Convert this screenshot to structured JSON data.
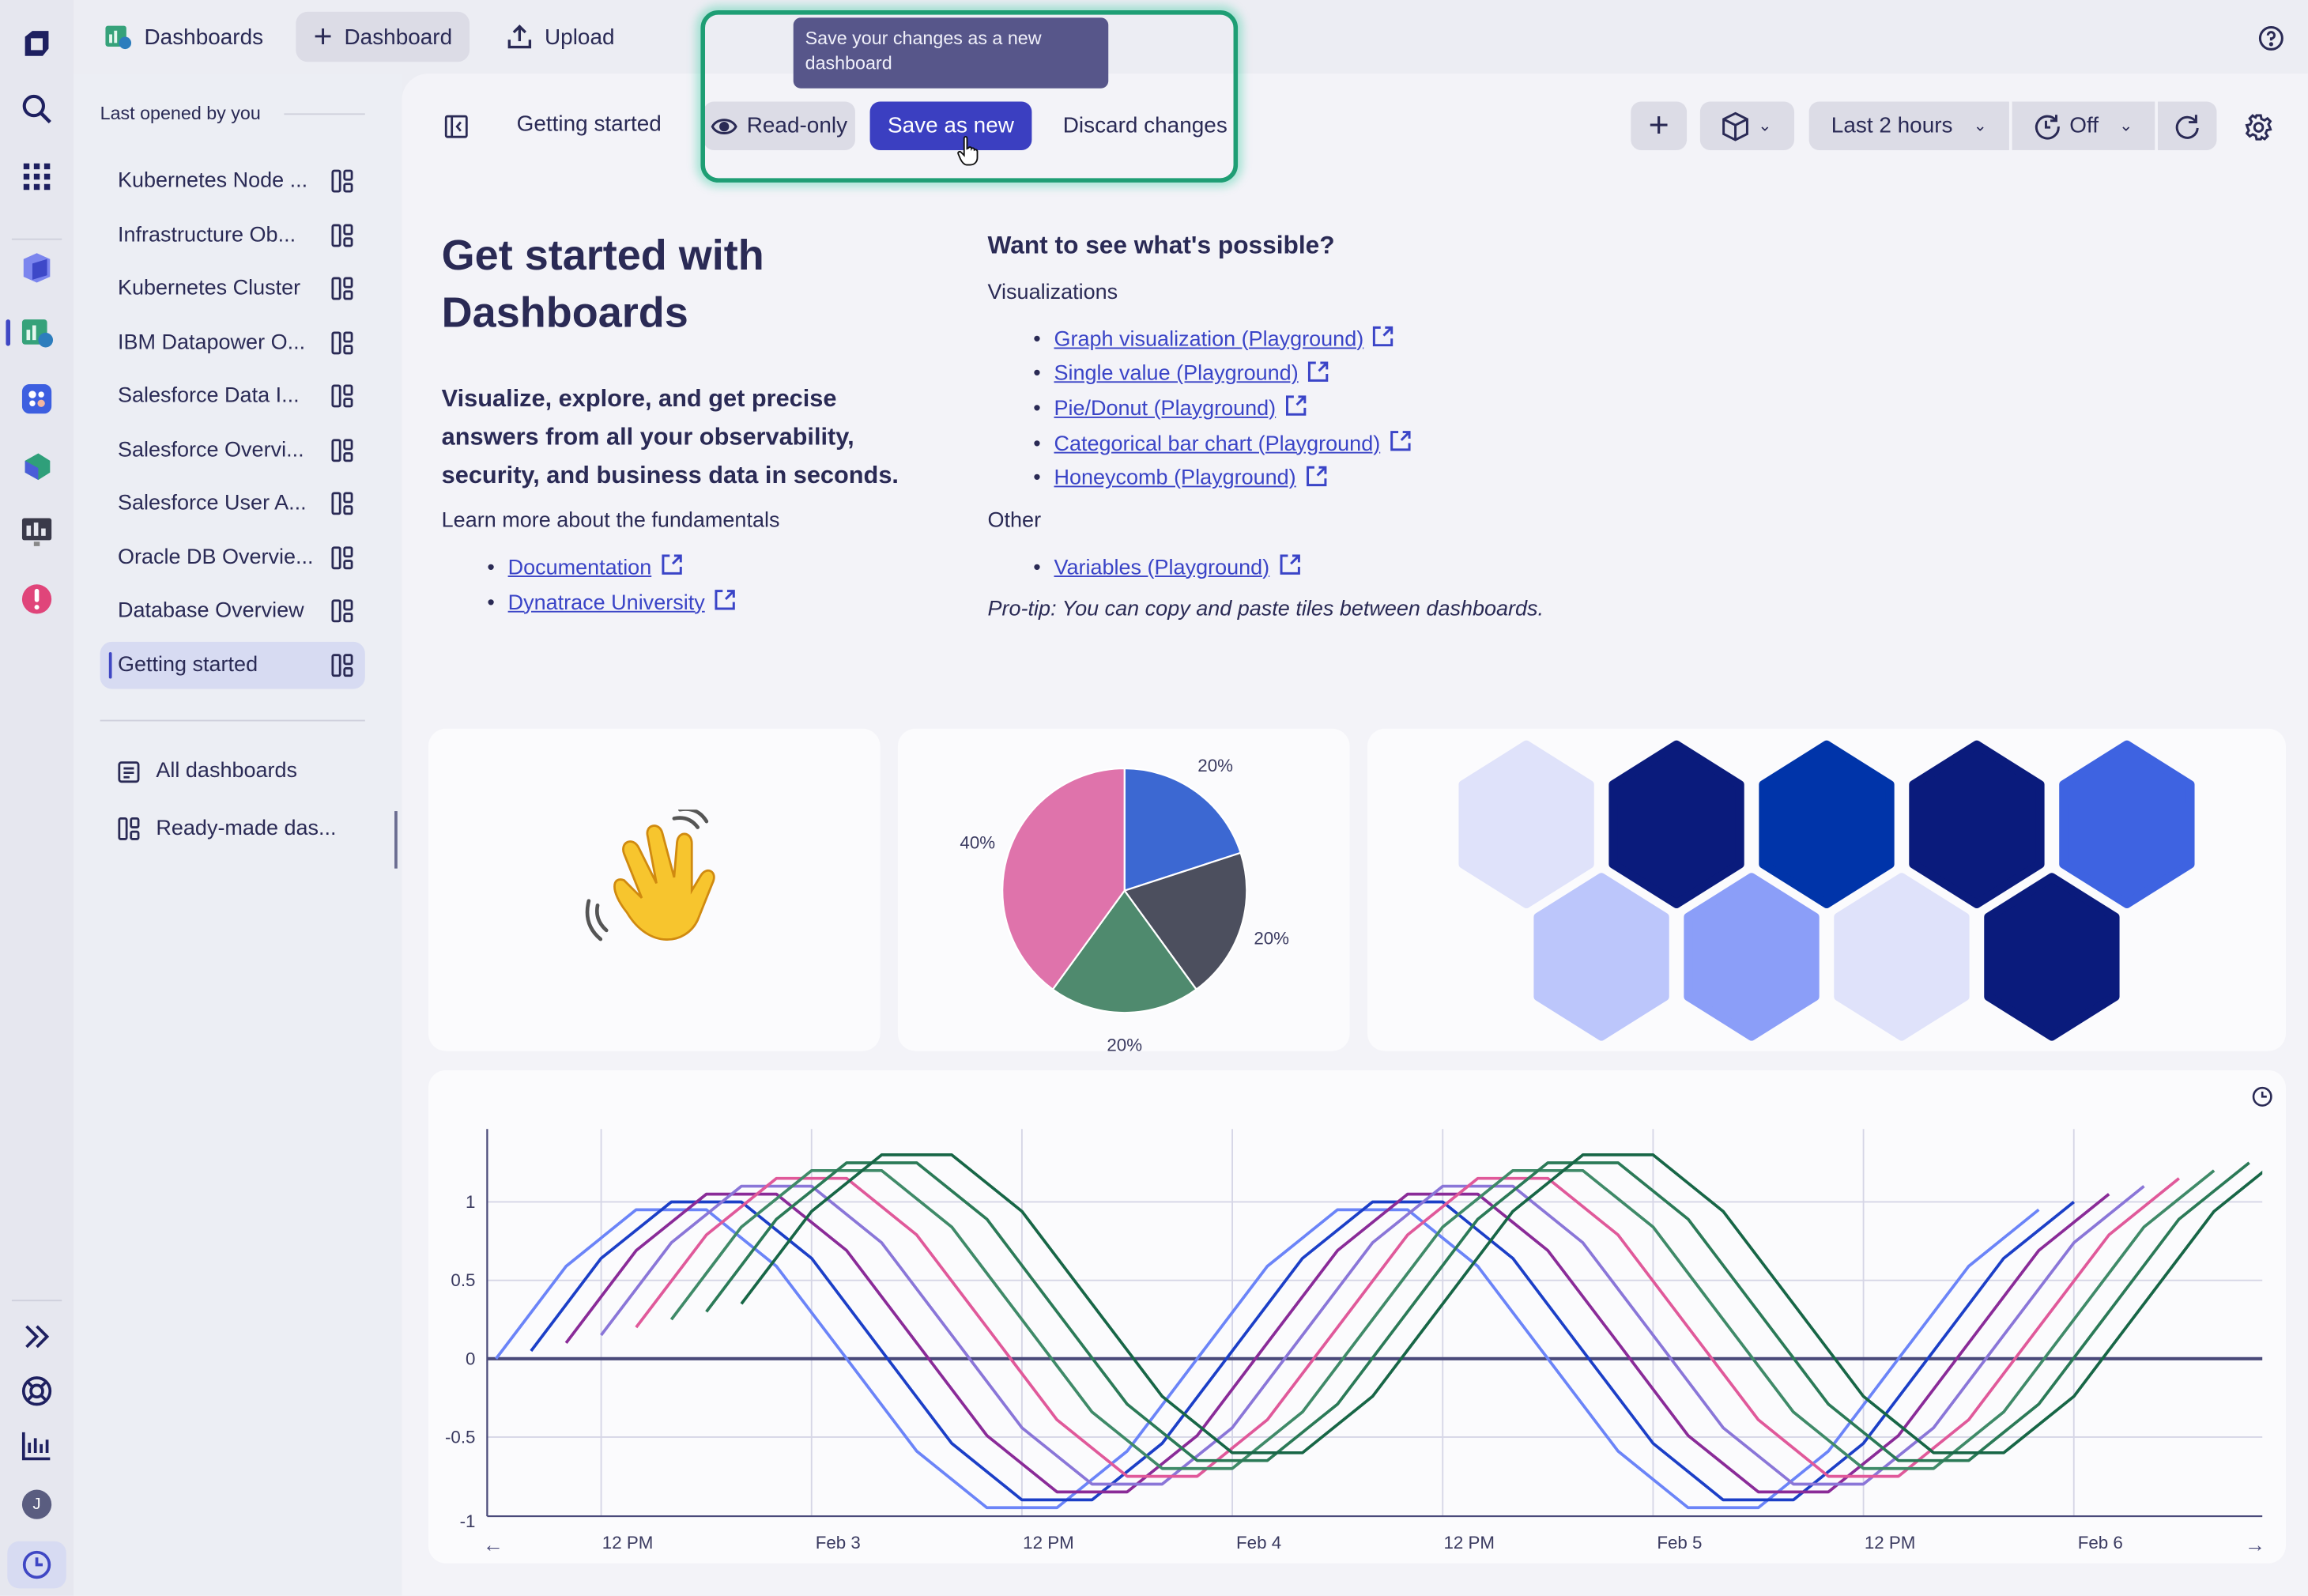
{
  "topbar": {
    "app_label": "Dashboards",
    "new_dashboard_label": "Dashboard",
    "upload_label": "Upload"
  },
  "sidebar": {
    "section_title": "Last opened by you",
    "items": [
      {
        "label": "Kubernetes Node ..."
      },
      {
        "label": "Infrastructure Ob..."
      },
      {
        "label": "Kubernetes Cluster"
      },
      {
        "label": "IBM Datapower O..."
      },
      {
        "label": "Salesforce Data I..."
      },
      {
        "label": "Salesforce Overvi..."
      },
      {
        "label": "Salesforce User A..."
      },
      {
        "label": "Oracle DB Overvie..."
      },
      {
        "label": "Database Overview"
      },
      {
        "label": "Getting started",
        "active": true
      }
    ],
    "all_dashboards_label": "All dashboards",
    "ready_made_label": "Ready-made das..."
  },
  "rail": {
    "user_initial": "J"
  },
  "header": {
    "title": "Getting started",
    "read_only_label": "Read-only",
    "save_as_new_label": "Save as new",
    "discard_label": "Discard changes",
    "tooltip": "Save your changes as a new dashboard",
    "timeframe_label": "Last 2 hours",
    "refresh_label": "Off"
  },
  "intro": {
    "title_line1": "Get started with",
    "title_line2": "Dashboards",
    "subtitle": "Visualize, explore, and get precise answers from all your observability, security, and business data in seconds.",
    "learn_more": "Learn more about the fundamentals",
    "links": [
      "Documentation",
      "Dynatrace University"
    ]
  },
  "possible": {
    "heading": "Want to see what's possible?",
    "visualizations_label": "Visualizations",
    "visualization_links": [
      "Graph visualization (Playground)",
      "Single value (Playground)",
      "Pie/Donut (Playground)",
      "Categorical bar chart (Playground)",
      "Honeycomb (Playground)"
    ],
    "other_label": "Other",
    "other_links": [
      "Variables (Playground)"
    ],
    "pro_tip": "Pro-tip: You can copy and paste tiles between dashboards."
  },
  "colors": {
    "accent": "#3a3fc0",
    "highlight": "#1e9e74",
    "link": "#3a44c7",
    "text": "#2a2a55"
  },
  "chart_data": [
    {
      "type": "pie",
      "values": [
        20,
        20,
        20,
        40
      ],
      "labels": [
        "20%",
        "20%",
        "20%",
        "40%"
      ],
      "colors": [
        "#3c68d2",
        "#4c4f5e",
        "#4f8a6e",
        "#df73ab"
      ]
    },
    {
      "type": "heatmap",
      "variant": "honeycomb",
      "rows": [
        [
          "#dfe2fa",
          "#0a1b7c",
          "#0034a9",
          "#0a1b7c",
          "#3e63e1"
        ],
        [
          "#bcc6fb",
          "#8b9ef8",
          "#dfe2fa",
          "#0a1b7c"
        ]
      ]
    },
    {
      "type": "line",
      "xlim": [
        "Feb 2 05:30",
        "Feb 6 10:45"
      ],
      "ylim": [
        -1,
        1.45
      ],
      "yticks": [
        1,
        0.5,
        0,
        -0.5,
        -1
      ],
      "ytick_labels": [
        "1",
        "0.5",
        "0",
        "-0.5",
        "-1"
      ],
      "xtick_times": [
        "Feb 2 12:00",
        "Feb 3 00:00",
        "Feb 3 12:00",
        "Feb 4 00:00",
        "Feb 4 12:00",
        "Feb 5 00:00",
        "Feb 5 12:00",
        "Feb 6 00:00"
      ],
      "xtick_labels": [
        "12 PM",
        "Feb 3",
        "12 PM",
        "Feb 4",
        "12 PM",
        "Feb 5",
        "12 PM",
        "Feb 6"
      ],
      "grid": true,
      "interval_hours": 4,
      "series": [
        {
          "color": "#6b84f8",
          "start": "Feb 2 06:00",
          "values": [
            0,
            0.59,
            0.95,
            0.95,
            0.59,
            0,
            -0.59,
            -0.95,
            -0.95,
            -0.59,
            0,
            0.59,
            0.95,
            0.95,
            0.59,
            0,
            -0.59,
            -0.95,
            -0.95,
            -0.59,
            0,
            0.59,
            0.95
          ]
        },
        {
          "color": "#1c3fc7",
          "start": "Feb 2 08:00",
          "values": [
            0.05,
            0.64,
            1,
            1,
            0.64,
            0.05,
            -0.54,
            -0.9,
            -0.9,
            -0.54,
            0.05,
            0.64,
            1,
            1,
            0.64,
            0.05,
            -0.54,
            -0.9,
            -0.9,
            -0.54,
            0.05,
            0.64,
            1
          ]
        },
        {
          "color": "#8a2b98",
          "start": "Feb 2 10:00",
          "values": [
            0.1,
            0.69,
            1.05,
            1.05,
            0.69,
            0.1,
            -0.49,
            -0.85,
            -0.85,
            -0.49,
            0.1,
            0.69,
            1.05,
            1.05,
            0.69,
            0.1,
            -0.49,
            -0.85,
            -0.85,
            -0.49,
            0.1,
            0.69,
            1.05
          ]
        },
        {
          "color": "#8a76d8",
          "start": "Feb 2 12:00",
          "values": [
            0.15,
            0.74,
            1.1,
            1.1,
            0.74,
            0.15,
            -0.44,
            -0.8,
            -0.8,
            -0.44,
            0.15,
            0.74,
            1.1,
            1.1,
            0.74,
            0.15,
            -0.44,
            -0.8,
            -0.8,
            -0.44,
            0.15,
            0.74,
            1.1
          ]
        },
        {
          "color": "#e0599a",
          "start": "Feb 2 14:00",
          "values": [
            0.2,
            0.79,
            1.15,
            1.15,
            0.79,
            0.2,
            -0.39,
            -0.75,
            -0.75,
            -0.39,
            0.2,
            0.79,
            1.15,
            1.15,
            0.79,
            0.2,
            -0.39,
            -0.75,
            -0.75,
            -0.39,
            0.2,
            0.79,
            1.15
          ]
        },
        {
          "color": "#3f8a68",
          "start": "Feb 2 16:00",
          "values": [
            0.25,
            0.84,
            1.2,
            1.2,
            0.84,
            0.25,
            -0.34,
            -0.7,
            -0.7,
            -0.34,
            0.25,
            0.84,
            1.2,
            1.2,
            0.84,
            0.25,
            -0.34,
            -0.7,
            -0.7,
            -0.34,
            0.25,
            0.84,
            1.2
          ]
        },
        {
          "color": "#2b7a57",
          "start": "Feb 2 18:00",
          "values": [
            0.3,
            0.89,
            1.25,
            1.25,
            0.89,
            0.3,
            -0.29,
            -0.65,
            -0.65,
            -0.29,
            0.3,
            0.89,
            1.25,
            1.25,
            0.89,
            0.3,
            -0.29,
            -0.65,
            -0.65,
            -0.29,
            0.3,
            0.89,
            1.25
          ]
        },
        {
          "color": "#176646",
          "start": "Feb 2 20:00",
          "values": [
            0.35,
            0.94,
            1.3,
            1.3,
            0.94,
            0.35,
            -0.24,
            -0.6,
            -0.6,
            -0.24,
            0.35,
            0.94,
            1.3,
            1.3,
            0.94,
            0.35,
            -0.24,
            -0.6,
            -0.6,
            -0.24,
            0.35,
            0.94,
            1.3
          ]
        }
      ]
    }
  ]
}
